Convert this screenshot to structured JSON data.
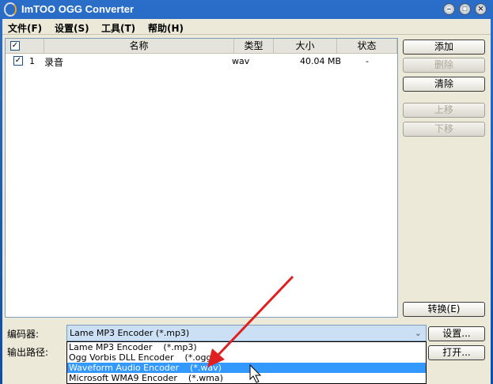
{
  "window": {
    "title": "ImTOO OGG Converter",
    "controls": [
      "minimize",
      "maximize",
      "close"
    ]
  },
  "menu": [
    "文件(F)",
    "设置(S)",
    "工具(T)",
    "帮助(H)"
  ],
  "table": {
    "headers": [
      "名称",
      "类型",
      "大小",
      "状态"
    ],
    "rows": [
      {
        "checked": true,
        "index": "1",
        "name": "录音",
        "type": "wav",
        "size": "40.04 MB",
        "status": "-"
      }
    ]
  },
  "buttons": {
    "add": "添加",
    "delete": "删除",
    "clear": "清除",
    "up": "上移",
    "down": "下移",
    "convert": "转换(E)",
    "settings": "设置...",
    "open": "打开..."
  },
  "encoder": {
    "label": "编码器:",
    "value": "Lame MP3 Encoder    (*.mp3)",
    "options": [
      "Lame MP3 Encoder    (*.mp3)",
      "Ogg Vorbis DLL Encoder    (*.ogg)",
      "Waveform Audio Encoder    (*.wav)",
      "Microsoft WMA9 Encoder    (*.wma)"
    ],
    "highlighted": 2
  },
  "output": {
    "label": "输出路径:"
  }
}
